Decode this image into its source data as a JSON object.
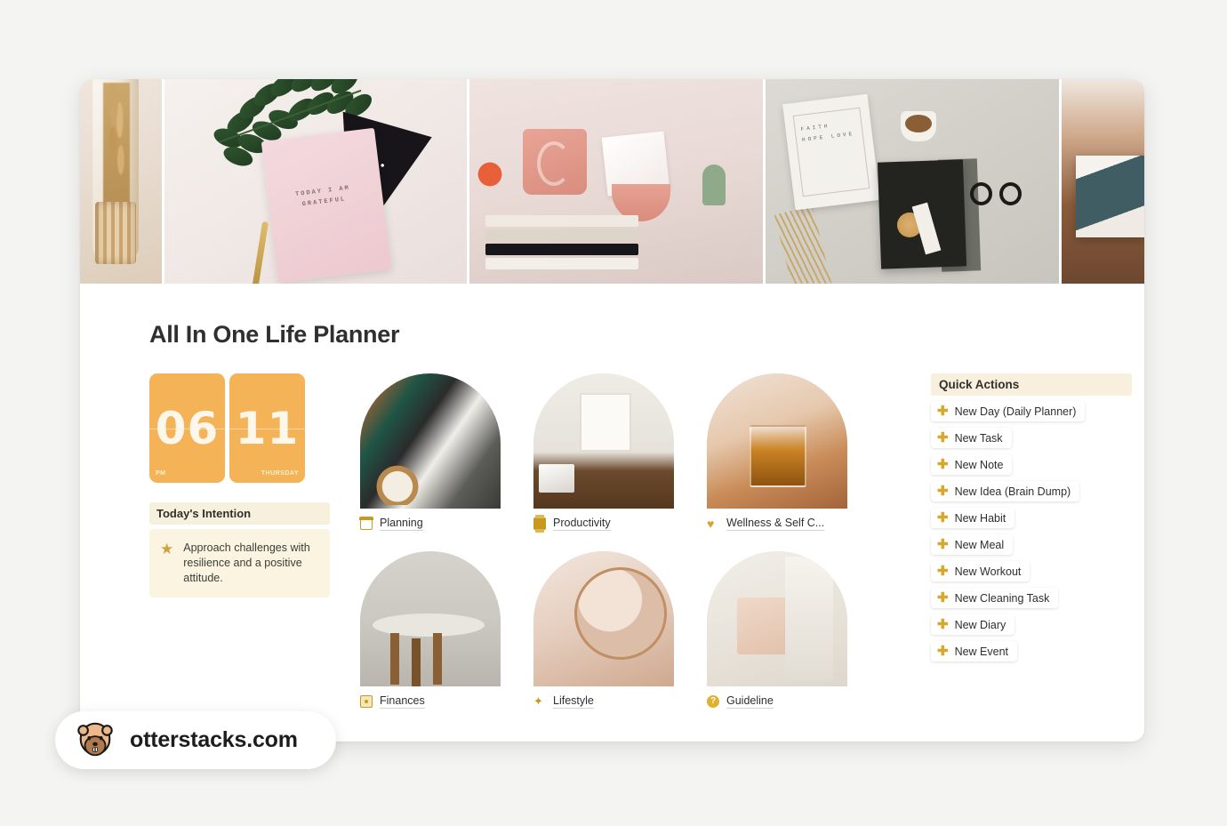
{
  "page": {
    "title": "All In One Life Planner"
  },
  "cover": {
    "badge_icon": "gold-double-square-icon",
    "panes": [
      {
        "name": "dried-pampas-in-glass-bottle"
      },
      {
        "name": "pink-gratitude-journal-with-leaf",
        "book_text": "TODAY\nI AM\nGRATEFUL"
      },
      {
        "name": "pink-mug-on-book-stack"
      },
      {
        "name": "faith-hope-love-card-flatlay",
        "card_text": "FAITH\nHOPE\nLOVE"
      },
      {
        "name": "photo-on-wooden-table"
      }
    ]
  },
  "clock": {
    "hour": "06",
    "hour_meridiem": "PM",
    "day_number": "11",
    "weekday": "THURSDAY"
  },
  "intention": {
    "heading": "Today's Intention",
    "icon": "star-icon",
    "text": "Approach challenges with resilience and a positive attitude."
  },
  "categories": [
    {
      "label": "Planning",
      "icon": "calendar-icon"
    },
    {
      "label": "Productivity",
      "icon": "printer-icon"
    },
    {
      "label": "Wellness & Self C...",
      "icon": "heart-icon"
    },
    {
      "label": "Finances",
      "icon": "money-icon"
    },
    {
      "label": "Lifestyle",
      "icon": "sparkles-icon"
    },
    {
      "label": "Guideline",
      "icon": "question-circle-icon"
    }
  ],
  "quick_actions": {
    "heading": "Quick Actions",
    "plus_icon": "plus-icon",
    "items": [
      {
        "label": "New Day (Daily Planner)"
      },
      {
        "label": "New Task"
      },
      {
        "label": "New Note"
      },
      {
        "label": "New Idea (Brain Dump)"
      },
      {
        "label": "New Habit"
      },
      {
        "label": "New Meal"
      },
      {
        "label": "New Workout"
      },
      {
        "label": "New Cleaning Task"
      },
      {
        "label": "New Diary"
      },
      {
        "label": "New Event"
      }
    ]
  },
  "watermark": {
    "text": "otterstacks.com",
    "icon": "otter-logo-icon"
  },
  "colors": {
    "accent_orange": "#f5b358",
    "accent_gold": "#c79a1f",
    "cream_header": "#f8f0dc",
    "intention_bg": "#fbf4e1",
    "page_bg": "#f4f4f2",
    "text": "#2f2f2f"
  }
}
